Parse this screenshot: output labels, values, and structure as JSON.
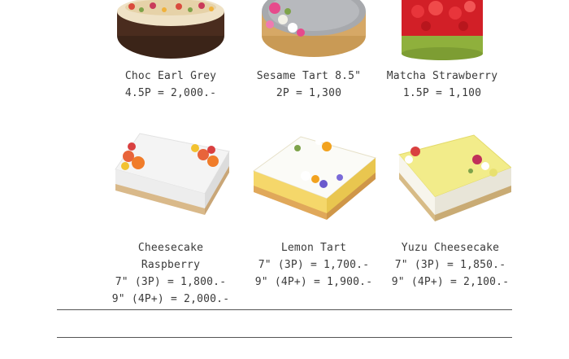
{
  "menu": {
    "row1": [
      {
        "name": "Choc Earl Grey",
        "prices": [
          "4.5P = 2,000.-"
        ],
        "image": "chocolate-earl-grey-cake"
      },
      {
        "name": "Sesame Tart 8.5\"",
        "prices": [
          "2P = 1,300"
        ],
        "image": "sesame-tart"
      },
      {
        "name": "Matcha Strawberry",
        "prices": [
          "1.5P = 1,100"
        ],
        "image": "matcha-strawberry-cake"
      }
    ],
    "row2": [
      {
        "name": "Cheesecake Raspberry",
        "prices": [
          "7\" (3P) = 1,800.-",
          "9\" (4P+) = 2,000.-"
        ],
        "image": "cheesecake-raspberry"
      },
      {
        "name": "Lemon Tart",
        "prices": [
          "7\" (3P) = 1,700.-",
          "9\" (4P+) = 1,900.-"
        ],
        "image": "lemon-tart"
      },
      {
        "name": "Yuzu Cheesecake",
        "prices": [
          "7\" (3P) = 1,850.-",
          "9\" (4P+) = 2,100.-"
        ],
        "image": "yuzu-cheesecake"
      }
    ]
  }
}
